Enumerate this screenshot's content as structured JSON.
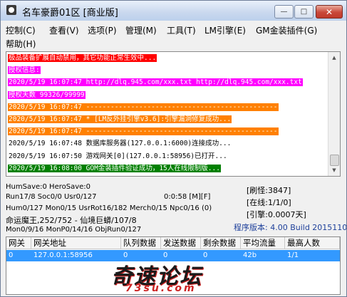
{
  "window": {
    "title": "名车豪爵01区 [商业版]",
    "min_label": "—",
    "max_label": "□",
    "close_label": "✕"
  },
  "menu": [
    {
      "label": "控制(C)"
    },
    {
      "label": "查看(V)"
    },
    {
      "label": "选项(P)"
    },
    {
      "label": "管理(M)"
    },
    {
      "label": "工具(T)"
    },
    {
      "label": "LM引擎(E)"
    },
    {
      "label": "GM金装插件(G)"
    },
    {
      "label": "帮助(H)"
    }
  ],
  "log": [
    {
      "text": "极品装备扩展自动禁用，其它功能正常生效中...",
      "bg": "#ff0000",
      "fg": "#ffffff"
    },
    {
      "text": "授权信息:",
      "bg": "#ff00ff",
      "fg": "#ffffff"
    },
    {
      "text": "2020/5/19 16:07:47 http://dlq.945.com/xxx.txt http://dlq.945.com/xxx.txt",
      "bg": "#ff00ff",
      "fg": "#ffffff"
    },
    {
      "text": "授权天数 99326/99999",
      "bg": "#ff00ff",
      "fg": "#ffffff"
    },
    {
      "text": "2020/5/19 16:07:47 -----------------------------------------------",
      "bg": "#ff8000",
      "fg": "#ffffff"
    },
    {
      "text": "2020/5/19 16:07:47 * [LM反外挂引擎v3.6]:引擎漏洞修复成功...",
      "bg": "#ff8000",
      "fg": "#ffffff"
    },
    {
      "text": "2020/5/19 16:07:47 -----------------------------------------------",
      "bg": "#ff8000",
      "fg": "#ffffff"
    },
    {
      "text": "2020/5/19 16:07:48 数据库服务器(127.0.0.1:6000)连接成功...",
      "bg": "#ffffff",
      "fg": "#000000"
    },
    {
      "text": "2020/5/19 16:07:50 游戏网关[0](127.0.0.1:58956)已打开...",
      "bg": "#ffffff",
      "fg": "#000000"
    },
    {
      "text": "2020/5/19 16:08:00 GOM金装插件验证成功，15人在线限制版...",
      "bg": "#008000",
      "fg": "#ffffff"
    }
  ],
  "status": {
    "line1": "HumSave:0 HeroSave:0",
    "line2_left": "Run17/8 Soc0/0 Usr0/127",
    "line2_right": "0:0:58 [M][F]",
    "line3": "Hum0/127 Mon0/15 UsrRot16/182 Merch0/15 Npc0/16 (0)",
    "line4": "命运魔王,252/752 - 仙境巨蟒/107/8",
    "line5": "Mon0/9/16 MonP0/14/16 ObjRun0/127",
    "stat_refresh": "[刷怪:3847]",
    "stat_online": "[在线:1/1/0]",
    "stat_engine": "[引擎:0.0007天]",
    "version": "程序版本: 4.00 Build 20151104"
  },
  "grid": {
    "headers": [
      "网关",
      "网关地址",
      "队列数据",
      "发送数据",
      "剩余数据",
      "平均流量",
      "最高人数"
    ],
    "rows": [
      [
        "0",
        "127.0.0.1:58956",
        "0",
        "0",
        "0",
        "42b",
        "1/1"
      ]
    ]
  },
  "watermark": {
    "cn": "奇速论坛",
    "en": "73su.com"
  },
  "colors": {
    "selected_row": "#3399ff",
    "accent_red": "#ff0000",
    "magenta": "#ff00ff",
    "orange": "#ff8000",
    "green": "#008000"
  }
}
